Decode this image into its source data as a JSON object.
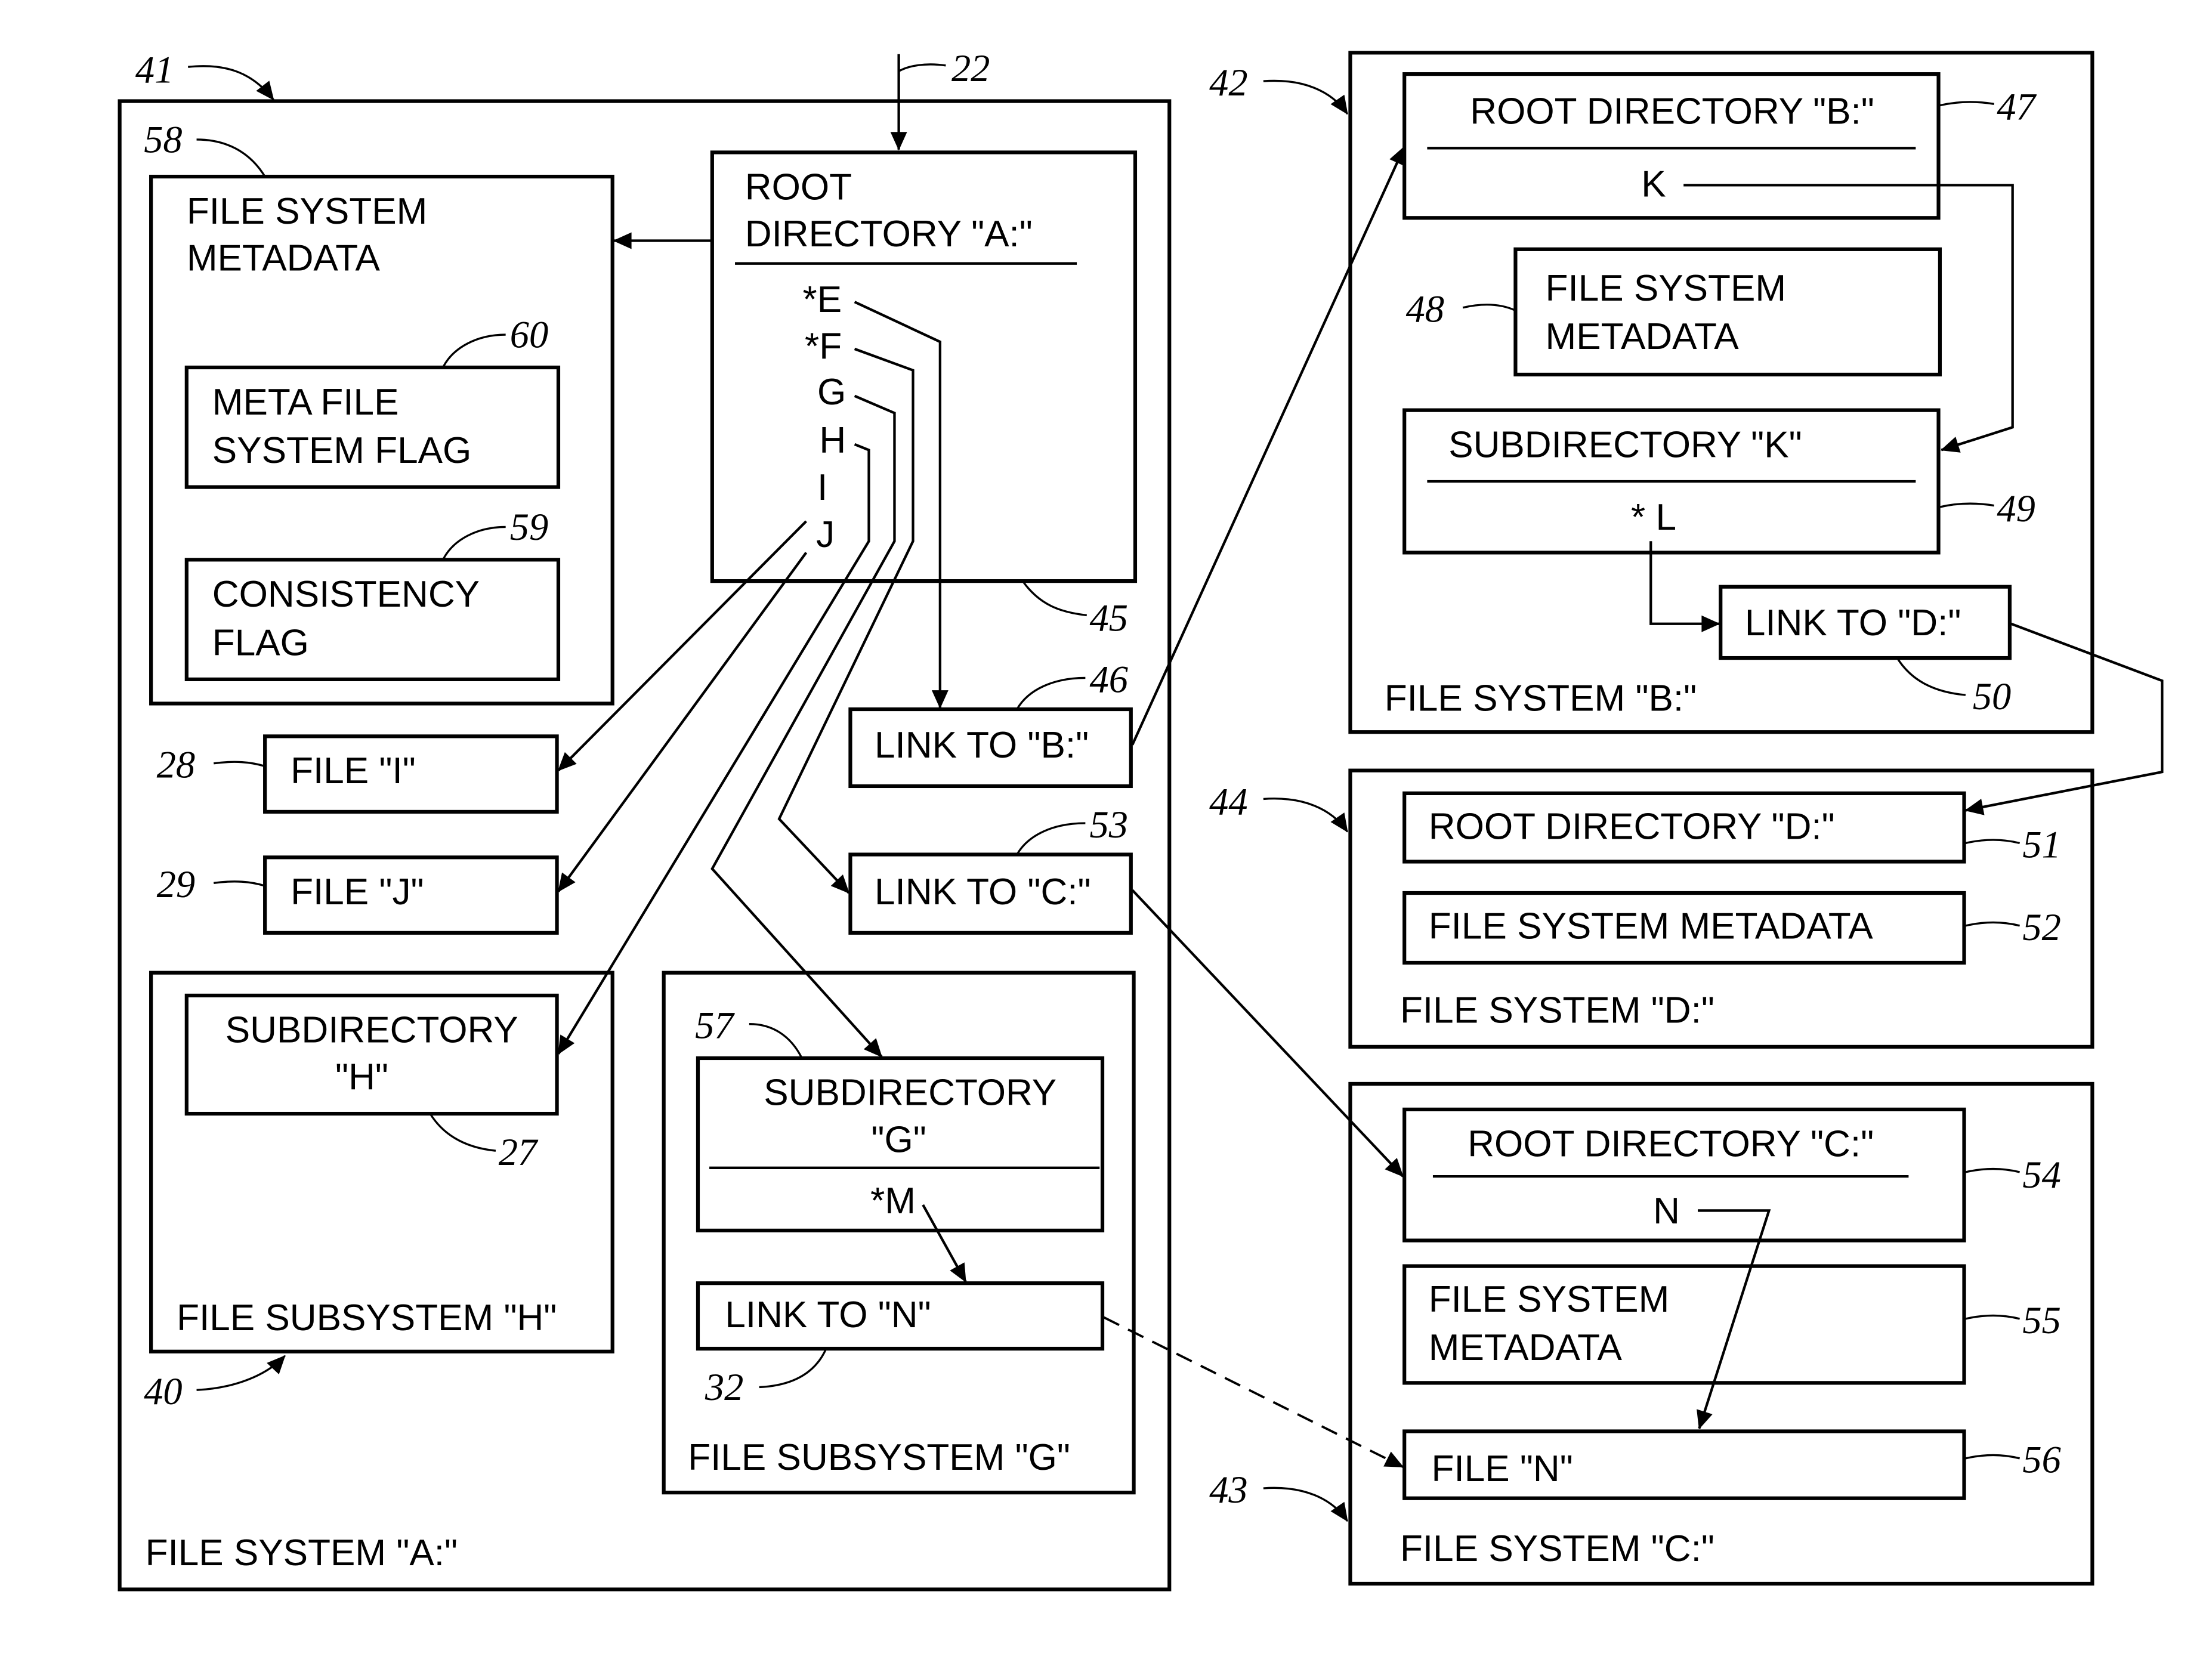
{
  "figure": {
    "file_system_a": {
      "ref": "41",
      "label": "FILE SYSTEM \"A:\"",
      "entry_ref": "22",
      "metadata": {
        "ref": "58",
        "line1": "FILE SYSTEM",
        "line2": "METADATA",
        "meta_flag": {
          "ref": "60",
          "line1": "META FILE",
          "line2": "SYSTEM FLAG"
        },
        "consistency_flag": {
          "ref": "59",
          "line1": "CONSISTENCY",
          "line2": "FLAG"
        }
      },
      "root_directory": {
        "ref": "45",
        "line1": "ROOT",
        "line2": "DIRECTORY \"A:\"",
        "entries": [
          "*E",
          "*F",
          "G",
          "H",
          "I",
          "J"
        ]
      },
      "file_i": {
        "ref": "28",
        "label": "FILE \"I\""
      },
      "file_j": {
        "ref": "29",
        "label": "FILE \"J\""
      },
      "link_b": {
        "ref": "46",
        "label": "LINK TO \"B:\""
      },
      "link_c": {
        "ref": "53",
        "label": "LINK TO \"C:\""
      },
      "subsystem_h": {
        "ref": "40",
        "label": "FILE SUBSYSTEM \"H\"",
        "subdirectory": {
          "ref": "27",
          "line1": "SUBDIRECTORY",
          "line2": "\"H\""
        }
      },
      "subsystem_g": {
        "label": "FILE SUBSYSTEM \"G\"",
        "subdirectory": {
          "ref": "57",
          "line1": "SUBDIRECTORY",
          "line2": "\"G\"",
          "entry": "*M"
        },
        "link_n": {
          "ref": "32",
          "label": "LINK TO \"N\""
        }
      }
    },
    "file_system_b": {
      "ref": "42",
      "label": "FILE SYSTEM \"B:\"",
      "root_directory": {
        "ref": "47",
        "label": "ROOT DIRECTORY \"B:\"",
        "entry": "K"
      },
      "metadata": {
        "ref": "48",
        "line1": "FILE SYSTEM",
        "line2": "METADATA"
      },
      "subdirectory_k": {
        "ref": "49",
        "label": "SUBDIRECTORY \"K\"",
        "entry": "* L"
      },
      "link_d": {
        "ref": "50",
        "label": "LINK TO \"D:\""
      }
    },
    "file_system_d": {
      "ref": "44",
      "label": "FILE SYSTEM \"D:\"",
      "root_directory": {
        "ref": "51",
        "label": "ROOT DIRECTORY \"D:\""
      },
      "metadata": {
        "ref": "52",
        "label": "FILE SYSTEM METADATA"
      }
    },
    "file_system_c": {
      "ref": "43",
      "label": "FILE SYSTEM \"C:\"",
      "root_directory": {
        "ref": "54",
        "label": "ROOT DIRECTORY \"C:\"",
        "entry": "N"
      },
      "metadata": {
        "ref": "55",
        "line1": "FILE SYSTEM",
        "line2": "METADATA"
      },
      "file_n": {
        "ref": "56",
        "label": "FILE \"N\""
      }
    }
  }
}
